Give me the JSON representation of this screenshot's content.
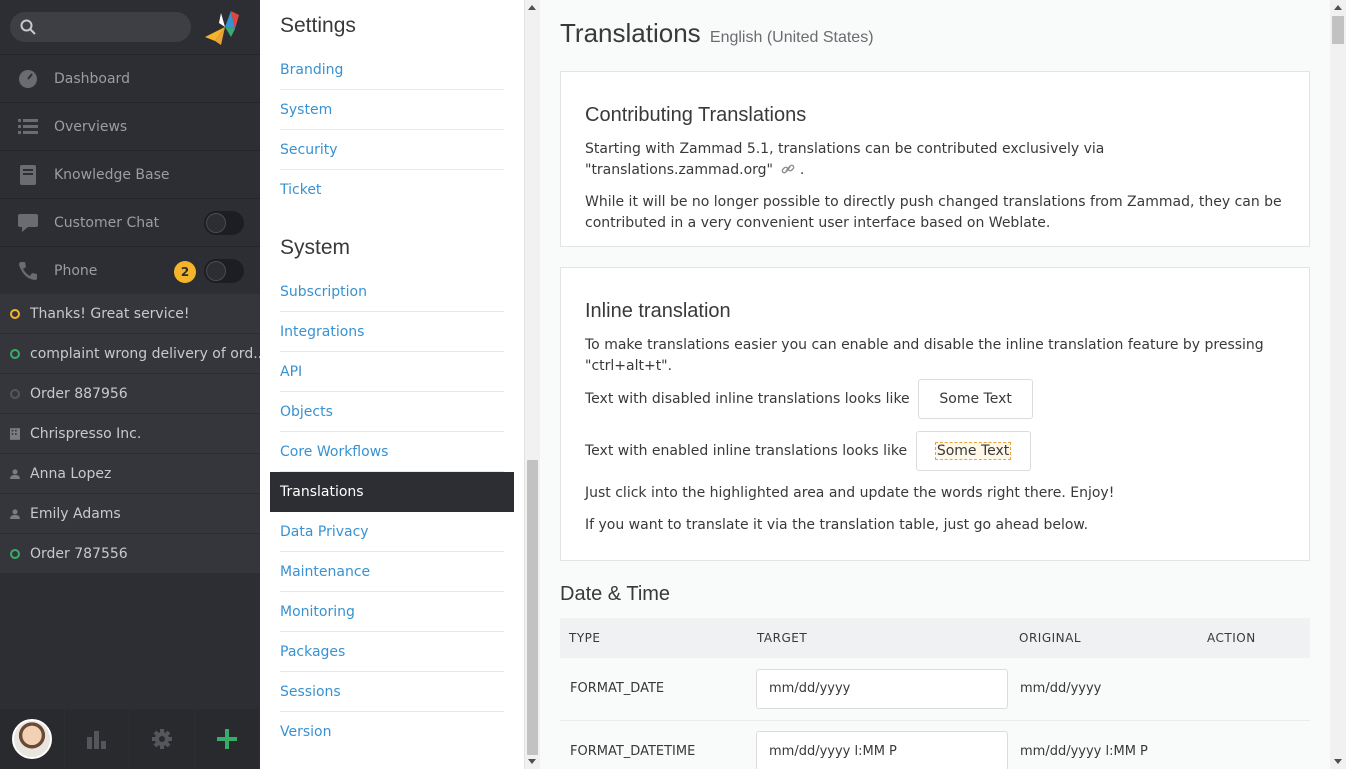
{
  "nav": {
    "items": [
      {
        "label": "Dashboard",
        "icon": "dashboard-icon"
      },
      {
        "label": "Overviews",
        "icon": "list-icon"
      },
      {
        "label": "Knowledge Base",
        "icon": "book-icon"
      },
      {
        "label": "Customer Chat",
        "icon": "chat-icon"
      },
      {
        "label": "Phone",
        "icon": "phone-icon",
        "badge": "2"
      }
    ],
    "tasks": [
      {
        "label": "Thanks! Great service!",
        "icon": "open-ticket-icon",
        "color": "#f5b52a"
      },
      {
        "label": "complaint wrong delivery of ord...",
        "icon": "open-ticket-icon",
        "color": "#38ad69"
      },
      {
        "label": "Order 887956",
        "icon": "closed-ticket-icon",
        "color": "#6b6c70"
      },
      {
        "label": "Chrispresso Inc.",
        "icon": "organization-icon"
      },
      {
        "label": "Anna Lopez",
        "icon": "user-icon"
      },
      {
        "label": "Emily Adams",
        "icon": "user-icon"
      },
      {
        "label": "Order 787556",
        "icon": "open-ticket-icon",
        "color": "#38ad69"
      }
    ]
  },
  "menu": {
    "settings_title": "Settings",
    "settings_items": [
      "Branding",
      "System",
      "Security",
      "Ticket"
    ],
    "system_title": "System",
    "system_items": [
      "Subscription",
      "Integrations",
      "API",
      "Objects",
      "Core Workflows",
      "Translations",
      "Data Privacy",
      "Maintenance",
      "Monitoring",
      "Packages",
      "Sessions",
      "Version"
    ],
    "active": "Translations"
  },
  "main": {
    "title": "Translations",
    "subtitle": "English (United States)",
    "contributing": {
      "heading": "Contributing Translations",
      "p1": "Starting with Zammad 5.1, translations can be contributed exclusively via \"translations.zammad.org\"",
      "p1_end": ".",
      "p2": "While it will be no longer possible to directly push changed translations from Zammad, they can be contributed in a very convenient user interface based on Weblate."
    },
    "inline": {
      "heading": "Inline translation",
      "p1": "To make translations easier you can enable and disable the inline translation feature by pressing \"ctrl+alt+t\".",
      "disabled_label": "Text with disabled inline translations looks like",
      "enabled_label": "Text with enabled inline translations looks like",
      "sample": "Some Text",
      "p2": "Just click into the highlighted area and update the words right there. Enjoy!",
      "p3": "If you want to translate it via the translation table, just go ahead below."
    },
    "datetime": {
      "heading": "Date & Time",
      "columns": [
        "TYPE",
        "TARGET",
        "ORIGINAL",
        "ACTION"
      ],
      "rows": [
        {
          "type": "FORMAT_DATE",
          "target": "mm/dd/yyyy",
          "original": "mm/dd/yyyy"
        },
        {
          "type": "FORMAT_DATETIME",
          "target": "mm/dd/yyyy l:MM P",
          "original": "mm/dd/yyyy l:MM P"
        }
      ]
    }
  },
  "colors": {
    "accent": "#3892d1",
    "nav_bg": "#2d2e33",
    "success": "#38ad69",
    "warning": "#f5b52a"
  }
}
